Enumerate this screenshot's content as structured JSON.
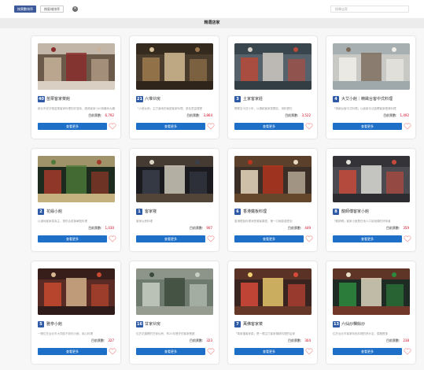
{
  "toolbar": {
    "sort_votes_label": "按票數排序",
    "sort_area_label": "按區域排序",
    "search_placeholder": "搜尋店家"
  },
  "section": {
    "title": "精選店家"
  },
  "common": {
    "votes_label": "目前票數:",
    "more_label": "查看更多"
  },
  "colors": {
    "accent": "#1e6fc7",
    "badge": "#2f5aa5",
    "votes": "#d0021b",
    "heart": "#f2a0a0"
  },
  "cards": [
    {
      "rank": "40",
      "name": "苗栗客家菜館",
      "desc": "新北市老字號苗栗客家料理的好滋味，經典客家小炒與薑絲大腸是必點",
      "votes": "6,792",
      "scene": "busy"
    },
    {
      "rank": "21",
      "name": "六堆伙房",
      "desc": "「六堆伙房」主打道地的南部客家料理，菜色豐富樸實",
      "votes": "3,864",
      "scene": "warm"
    },
    {
      "rank": "3",
      "name": "土家客家莊",
      "desc": "開業至今四十年，以傳統客家菜聞名，用料實在",
      "votes": "3,522",
      "scene": "kitchen"
    },
    {
      "rank": "4",
      "name": "大艾小館｜精緻台客中式料理",
      "desc": "「精緻台客中式料理」以創新手法詮釋客家經典料理",
      "votes": "1,492",
      "scene": "bright"
    },
    {
      "rank": "2",
      "name": "花緣小館",
      "desc": "以道地客家菜為主，提供合菜與單點料理",
      "votes": "1,030",
      "scene": "night"
    },
    {
      "rank": "1",
      "name": "客家棧",
      "desc": "客家伙房料理",
      "votes": "907",
      "scene": "dark"
    },
    {
      "rank": "6",
      "name": "香港鐵板料理",
      "desc": "香港鐵板料理深受饕客喜愛，第一口就能感受到",
      "votes": "449",
      "scene": "storefront"
    },
    {
      "rank": "8",
      "name": "龍師傅客家小館",
      "desc": "「龍師傅」客家小館是在地人口耳相傳的好味道",
      "votes": "359",
      "scene": "shop"
    },
    {
      "rank": "5",
      "name": "雅亭小館",
      "desc": "一間位在台北市大同區不到的小館，用心料理",
      "votes": "327",
      "scene": "interior"
    },
    {
      "rank": "16",
      "name": "甘家伙房",
      "desc": "位於花蓮縣的甘家伙房，有20年歷史的客家餐廳",
      "votes": "323",
      "scene": "hall"
    },
    {
      "rank": "7",
      "name": "萬佛客家菜",
      "desc": "「萬家福客家菜」是一間主打客家傳統料理的店家",
      "votes": "304",
      "scene": "street"
    },
    {
      "rank": "13",
      "name": "六仙炒粿餘炒",
      "desc": "位於台北市客家特色料理的熱炒店，價格實惠",
      "votes": "238",
      "scene": "neon"
    }
  ]
}
